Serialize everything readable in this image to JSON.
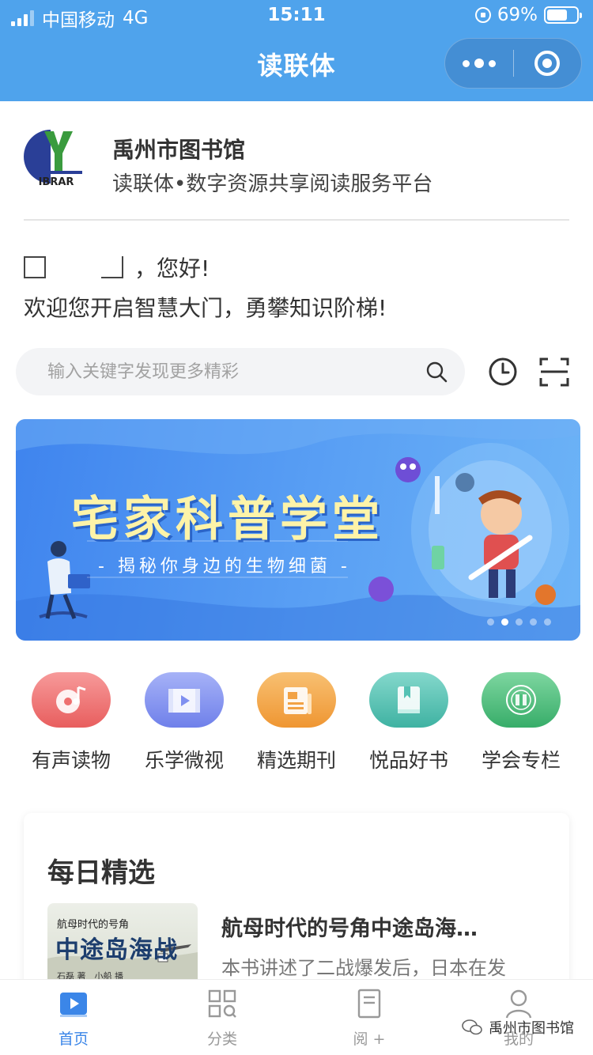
{
  "status_bar": {
    "carrier": "中国移动",
    "network": "4G",
    "time": "15:11",
    "battery": "69%",
    "battery_level": 0.69
  },
  "navbar": {
    "title": "读联体"
  },
  "library": {
    "name": "禹州市图书馆",
    "description": "读联体•数字资源共享阅读服务平台",
    "logo_text": "IBRAR"
  },
  "greeting": {
    "hello": "，您好!",
    "welcome": "欢迎您开启智慧大门，勇攀知识阶梯!"
  },
  "search": {
    "placeholder": "输入关键字发现更多精彩"
  },
  "banner": {
    "title": "宅家科普学堂",
    "subtitle": "- 揭秘你身边的生物细菌 -",
    "slide_count": 5,
    "active_slide": 2
  },
  "categories": [
    {
      "label": "有声读物",
      "icon": "audio-book-icon",
      "color": "#ee6f6f"
    },
    {
      "label": "乐学微视",
      "icon": "video-icon",
      "color": "#7f8ff0"
    },
    {
      "label": "精选期刊",
      "icon": "journal-icon",
      "color": "#f2a244"
    },
    {
      "label": "悦品好书",
      "icon": "book-icon",
      "color": "#55c2b4"
    },
    {
      "label": "学会专栏",
      "icon": "society-icon",
      "color": "#4ec07e"
    }
  ],
  "daily": {
    "title": "每日精选",
    "book": {
      "title": "航母时代的号角中途岛海…",
      "description": "本书讲述了二战爆发后，日本在发",
      "cover_small": "航母时代的号角",
      "cover_big": "中途岛海战",
      "cover_author": "石磊 著　小船 播"
    }
  },
  "tabs": [
    {
      "label": "首页",
      "icon": "home-play-icon",
      "active": true
    },
    {
      "label": "分类",
      "icon": "category-grid-icon",
      "active": false
    },
    {
      "label": "阅 +",
      "icon": "read-book-icon",
      "active": false
    },
    {
      "label": "我的",
      "icon": "profile-icon",
      "active": false
    }
  ],
  "watermark": {
    "text": "禹州市图书馆"
  },
  "colors": {
    "header": "#4fa3ec",
    "tab_active": "#3b86e8",
    "banner_title": "#fdf3a8"
  }
}
